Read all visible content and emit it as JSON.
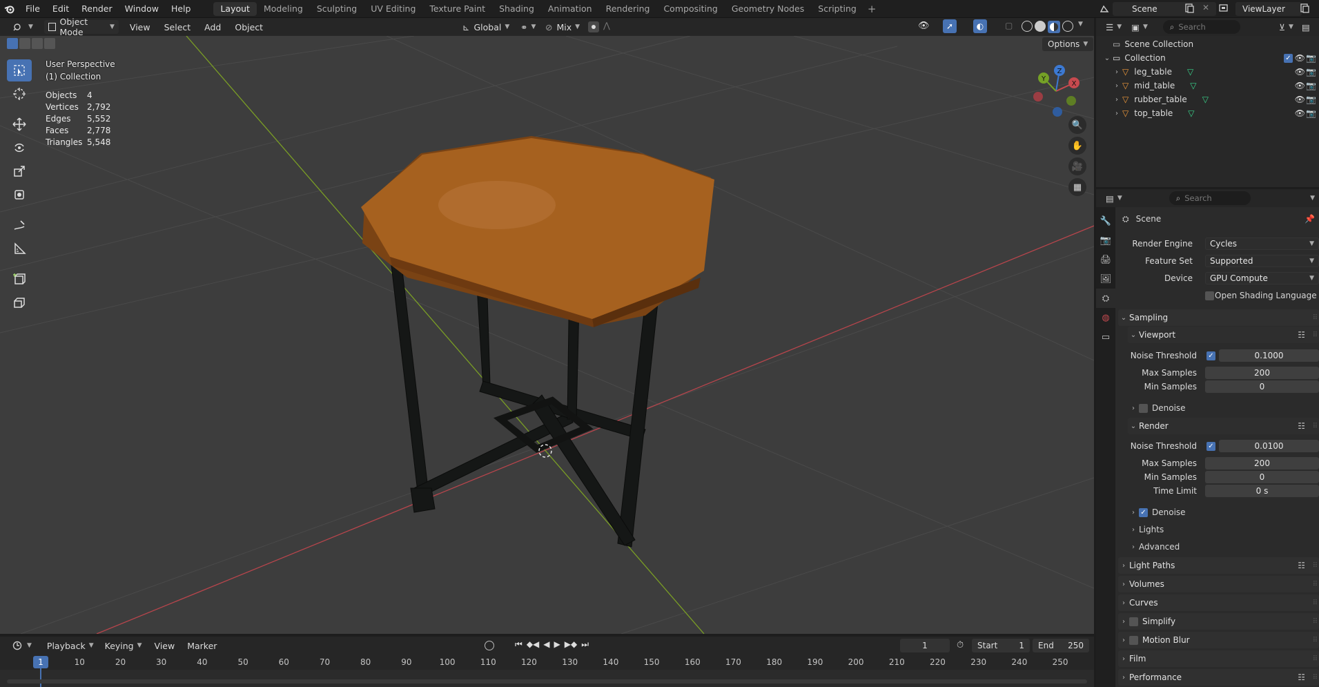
{
  "menubar": {
    "items": [
      "File",
      "Edit",
      "Render",
      "Window",
      "Help"
    ],
    "workspaces": [
      "Layout",
      "Modeling",
      "Sculpting",
      "UV Editing",
      "Texture Paint",
      "Shading",
      "Animation",
      "Rendering",
      "Compositing",
      "Geometry Nodes",
      "Scripting"
    ],
    "active_workspace": "Layout",
    "add_tab_symbol": "+",
    "scene": "Scene",
    "view_layer": "ViewLayer"
  },
  "viewport_header": {
    "mode": "Object Mode",
    "menus": [
      "View",
      "Select",
      "Add",
      "Object"
    ],
    "orientation": "Global",
    "snap_mix": "Mix",
    "options": "Options"
  },
  "viewport": {
    "perspective": "User Perspective",
    "collection": "(1) Collection",
    "stats": [
      {
        "label": "Objects",
        "value": "4"
      },
      {
        "label": "Vertices",
        "value": "2,792"
      },
      {
        "label": "Edges",
        "value": "5,552"
      },
      {
        "label": "Faces",
        "value": "2,778"
      },
      {
        "label": "Triangles",
        "value": "5,548"
      }
    ],
    "gizmo_axes": {
      "x": "X",
      "y": "Y",
      "z": "Z"
    },
    "colors": {
      "background": "#3d3d3d",
      "x_axis": "#c4484f",
      "y_axis": "#7ea323",
      "wood": "#a35f22",
      "metal": "#151716"
    }
  },
  "timeline": {
    "menus": [
      "Playback",
      "Keying",
      "View",
      "Marker"
    ],
    "current_frame": "1",
    "start_label": "Start",
    "start": "1",
    "end_label": "End",
    "end": "250",
    "ticks": [
      "1",
      "10",
      "20",
      "30",
      "40",
      "50",
      "60",
      "70",
      "80",
      "90",
      "100",
      "110",
      "120",
      "130",
      "140",
      "150",
      "160",
      "170",
      "180",
      "190",
      "200",
      "210",
      "220",
      "230",
      "240",
      "250"
    ]
  },
  "outliner": {
    "search_placeholder": "Search",
    "scene_collection": "Scene Collection",
    "collection": "Collection",
    "objects": [
      "leg_table",
      "mid_table",
      "rubber_table",
      "top_table"
    ]
  },
  "properties": {
    "search_placeholder": "Search",
    "context": "Scene",
    "render_engine_label": "Render Engine",
    "render_engine": "Cycles",
    "feature_set_label": "Feature Set",
    "feature_set": "Supported",
    "device_label": "Device",
    "device": "GPU Compute",
    "osl_label": "Open Shading Language",
    "sampling": "Sampling",
    "viewport_panel": "Viewport",
    "render_panel": "Render",
    "noise_threshold_label": "Noise Threshold",
    "max_samples_label": "Max Samples",
    "min_samples_label": "Min Samples",
    "time_limit_label": "Time Limit",
    "denoise_label": "Denoise",
    "viewport_noise_threshold": "0.1000",
    "viewport_max_samples": "200",
    "viewport_min_samples": "0",
    "render_noise_threshold": "0.0100",
    "render_max_samples": "200",
    "render_min_samples": "0",
    "render_time_limit": "0 s",
    "lights": "Lights",
    "advanced": "Advanced",
    "light_paths": "Light Paths",
    "volumes": "Volumes",
    "curves": "Curves",
    "simplify": "Simplify",
    "motion_blur": "Motion Blur",
    "film": "Film",
    "performance": "Performance"
  }
}
